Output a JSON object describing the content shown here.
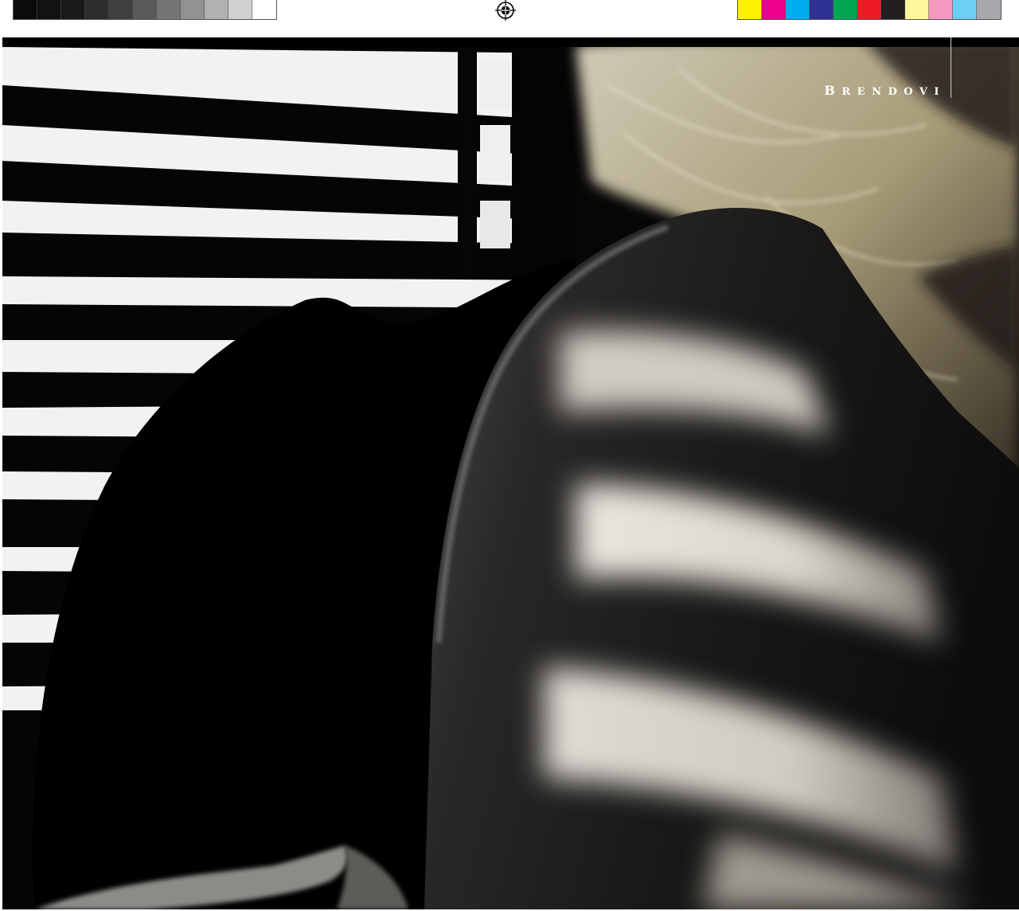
{
  "section": {
    "label_initial": "B",
    "label_rest": "RENDOVI"
  },
  "print_marks": {
    "grayscale_steps": [
      "#0b0b0b",
      "#121212",
      "#1c1a19",
      "#2e2c2c",
      "#403e3e",
      "#5a5858",
      "#767474",
      "#939191",
      "#b2b0b0",
      "#d2d0d0",
      "#ffffff"
    ],
    "color_steps": [
      "#fff200",
      "#ec008c",
      "#00aeef",
      "#2e3192",
      "#00a651",
      "#ed1c24",
      "#231f20",
      "#fff799",
      "#f49ac2",
      "#6dcff6",
      "#a7a9ac"
    ]
  },
  "photo": {
    "icon": "photograph-icon"
  }
}
